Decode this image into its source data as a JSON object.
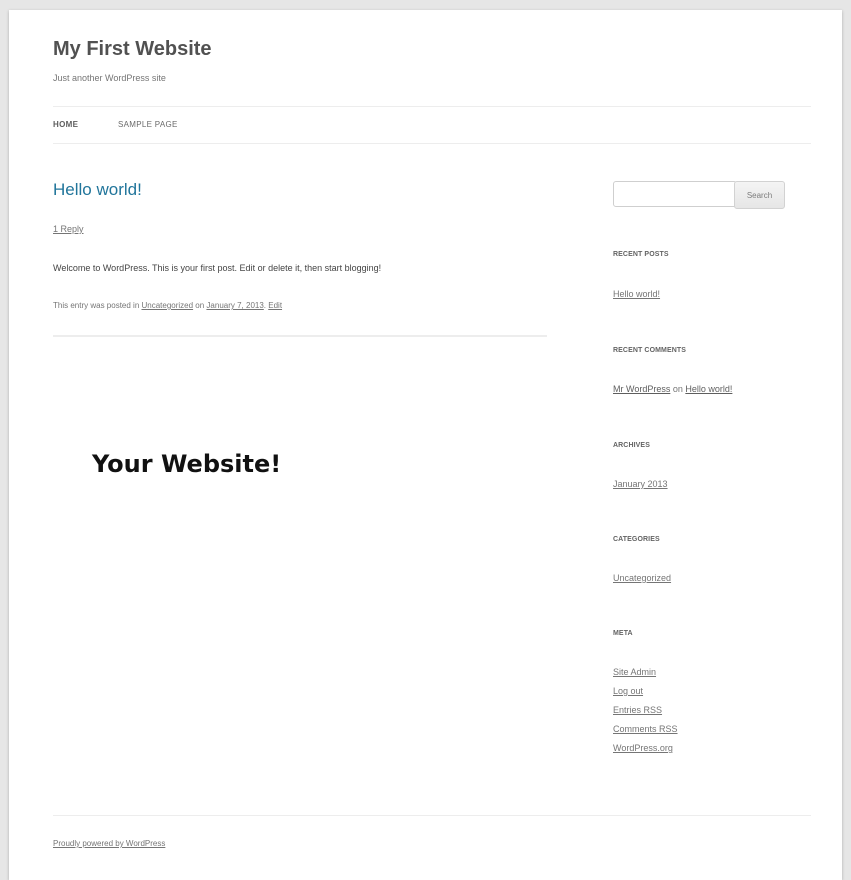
{
  "site": {
    "title": "My First Website",
    "description": "Just another WordPress site"
  },
  "nav": {
    "items": [
      {
        "label": "HOME"
      },
      {
        "label": "SAMPLE PAGE"
      }
    ]
  },
  "post": {
    "title": "Hello world!",
    "reply_link": "1 Reply",
    "content": "Welcome to WordPress. This is your first post. Edit or delete it, then start blogging!",
    "meta_prefix": "This entry was posted in ",
    "category": "Uncategorized",
    "meta_on": " on ",
    "date": "January 7, 2013",
    "meta_sep": ". ",
    "edit": "Edit"
  },
  "overlay": {
    "text": "Your Website!"
  },
  "sidebar": {
    "search": {
      "value": "",
      "button_label": "Search"
    },
    "recent_posts": {
      "title": "RECENT POSTS",
      "items": [
        "Hello world!"
      ]
    },
    "recent_comments": {
      "title": "RECENT COMMENTS",
      "author": "Mr WordPress",
      "on": " on ",
      "post": "Hello world!"
    },
    "archives": {
      "title": "ARCHIVES",
      "items": [
        "January 2013"
      ]
    },
    "categories": {
      "title": "CATEGORIES",
      "items": [
        "Uncategorized"
      ]
    },
    "meta": {
      "title": "META",
      "items": [
        "Site Admin",
        "Log out",
        "Entries RSS",
        "Comments RSS",
        "WordPress.org"
      ]
    }
  },
  "footer": {
    "credit": "Proudly powered by WordPress"
  },
  "colors": {
    "link_blue": "#21759b",
    "background": "#e6e6e6"
  }
}
